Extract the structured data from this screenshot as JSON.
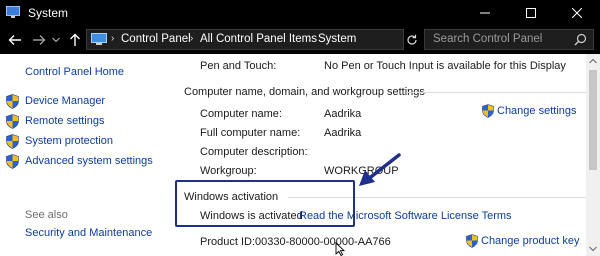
{
  "window": {
    "title": "System",
    "icon": "system-app-icon",
    "controls": [
      "minimize",
      "maximize",
      "close"
    ]
  },
  "address_bar": {
    "breadcrumbs": [
      "Control Panel",
      "All Control Panel Items",
      "System"
    ],
    "search_placeholder": "Search Control Panel"
  },
  "sidebar": {
    "home": "Control Panel Home",
    "items": [
      {
        "label": "Device Manager",
        "icon": "shield-icon"
      },
      {
        "label": "Remote settings",
        "icon": "shield-icon"
      },
      {
        "label": "System protection",
        "icon": "shield-icon"
      },
      {
        "label": "Advanced system settings",
        "icon": "shield-icon"
      }
    ],
    "see_also": "See also",
    "see_also_links": [
      "Security and Maintenance"
    ]
  },
  "main": {
    "pen_touch": {
      "label": "Pen and Touch:",
      "value": "No Pen or Touch Input is available for this Display"
    },
    "computer_group": {
      "heading": "Computer name, domain, and workgroup settings",
      "rows": [
        {
          "label": "Computer name:",
          "value": "Aadrika"
        },
        {
          "label": "Full computer name:",
          "value": "Aadrika"
        },
        {
          "label": "Computer description:",
          "value": ""
        },
        {
          "label": "Workgroup:",
          "value": "WORKGROUP"
        }
      ],
      "change_settings": "Change settings"
    },
    "activation": {
      "heading": "Windows activation",
      "status": "Windows is activated",
      "license_link": "Read the Microsoft Software License Terms",
      "product_id_label": "Product ID:",
      "product_id": "00330-80000-00000-AA766",
      "change_key": "Change product key"
    }
  },
  "colors": {
    "titlebar": "#000000",
    "link": "#0c3d9c",
    "annotation": "#1f2f8c"
  }
}
